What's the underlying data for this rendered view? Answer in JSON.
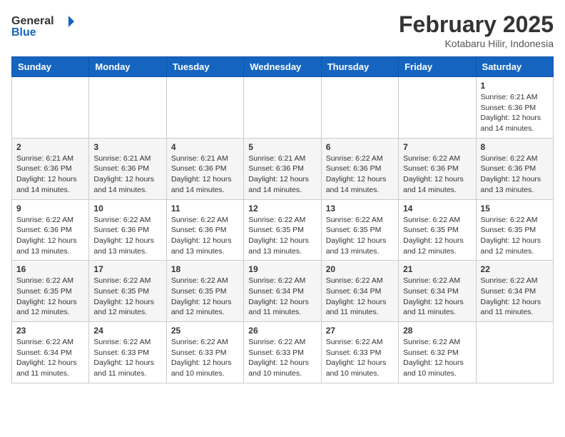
{
  "logo": {
    "line1": "General",
    "line2": "Blue"
  },
  "title": "February 2025",
  "location": "Kotabaru Hilir, Indonesia",
  "days_of_week": [
    "Sunday",
    "Monday",
    "Tuesday",
    "Wednesday",
    "Thursday",
    "Friday",
    "Saturday"
  ],
  "weeks": [
    [
      {
        "day": "",
        "info": ""
      },
      {
        "day": "",
        "info": ""
      },
      {
        "day": "",
        "info": ""
      },
      {
        "day": "",
        "info": ""
      },
      {
        "day": "",
        "info": ""
      },
      {
        "day": "",
        "info": ""
      },
      {
        "day": "1",
        "info": "Sunrise: 6:21 AM\nSunset: 6:36 PM\nDaylight: 12 hours\nand 14 minutes."
      }
    ],
    [
      {
        "day": "2",
        "info": "Sunrise: 6:21 AM\nSunset: 6:36 PM\nDaylight: 12 hours\nand 14 minutes."
      },
      {
        "day": "3",
        "info": "Sunrise: 6:21 AM\nSunset: 6:36 PM\nDaylight: 12 hours\nand 14 minutes."
      },
      {
        "day": "4",
        "info": "Sunrise: 6:21 AM\nSunset: 6:36 PM\nDaylight: 12 hours\nand 14 minutes."
      },
      {
        "day": "5",
        "info": "Sunrise: 6:21 AM\nSunset: 6:36 PM\nDaylight: 12 hours\nand 14 minutes."
      },
      {
        "day": "6",
        "info": "Sunrise: 6:22 AM\nSunset: 6:36 PM\nDaylight: 12 hours\nand 14 minutes."
      },
      {
        "day": "7",
        "info": "Sunrise: 6:22 AM\nSunset: 6:36 PM\nDaylight: 12 hours\nand 14 minutes."
      },
      {
        "day": "8",
        "info": "Sunrise: 6:22 AM\nSunset: 6:36 PM\nDaylight: 12 hours\nand 13 minutes."
      }
    ],
    [
      {
        "day": "9",
        "info": "Sunrise: 6:22 AM\nSunset: 6:36 PM\nDaylight: 12 hours\nand 13 minutes."
      },
      {
        "day": "10",
        "info": "Sunrise: 6:22 AM\nSunset: 6:36 PM\nDaylight: 12 hours\nand 13 minutes."
      },
      {
        "day": "11",
        "info": "Sunrise: 6:22 AM\nSunset: 6:36 PM\nDaylight: 12 hours\nand 13 minutes."
      },
      {
        "day": "12",
        "info": "Sunrise: 6:22 AM\nSunset: 6:35 PM\nDaylight: 12 hours\nand 13 minutes."
      },
      {
        "day": "13",
        "info": "Sunrise: 6:22 AM\nSunset: 6:35 PM\nDaylight: 12 hours\nand 13 minutes."
      },
      {
        "day": "14",
        "info": "Sunrise: 6:22 AM\nSunset: 6:35 PM\nDaylight: 12 hours\nand 12 minutes."
      },
      {
        "day": "15",
        "info": "Sunrise: 6:22 AM\nSunset: 6:35 PM\nDaylight: 12 hours\nand 12 minutes."
      }
    ],
    [
      {
        "day": "16",
        "info": "Sunrise: 6:22 AM\nSunset: 6:35 PM\nDaylight: 12 hours\nand 12 minutes."
      },
      {
        "day": "17",
        "info": "Sunrise: 6:22 AM\nSunset: 6:35 PM\nDaylight: 12 hours\nand 12 minutes."
      },
      {
        "day": "18",
        "info": "Sunrise: 6:22 AM\nSunset: 6:35 PM\nDaylight: 12 hours\nand 12 minutes."
      },
      {
        "day": "19",
        "info": "Sunrise: 6:22 AM\nSunset: 6:34 PM\nDaylight: 12 hours\nand 11 minutes."
      },
      {
        "day": "20",
        "info": "Sunrise: 6:22 AM\nSunset: 6:34 PM\nDaylight: 12 hours\nand 11 minutes."
      },
      {
        "day": "21",
        "info": "Sunrise: 6:22 AM\nSunset: 6:34 PM\nDaylight: 12 hours\nand 11 minutes."
      },
      {
        "day": "22",
        "info": "Sunrise: 6:22 AM\nSunset: 6:34 PM\nDaylight: 12 hours\nand 11 minutes."
      }
    ],
    [
      {
        "day": "23",
        "info": "Sunrise: 6:22 AM\nSunset: 6:34 PM\nDaylight: 12 hours\nand 11 minutes."
      },
      {
        "day": "24",
        "info": "Sunrise: 6:22 AM\nSunset: 6:33 PM\nDaylight: 12 hours\nand 11 minutes."
      },
      {
        "day": "25",
        "info": "Sunrise: 6:22 AM\nSunset: 6:33 PM\nDaylight: 12 hours\nand 10 minutes."
      },
      {
        "day": "26",
        "info": "Sunrise: 6:22 AM\nSunset: 6:33 PM\nDaylight: 12 hours\nand 10 minutes."
      },
      {
        "day": "27",
        "info": "Sunrise: 6:22 AM\nSunset: 6:33 PM\nDaylight: 12 hours\nand 10 minutes."
      },
      {
        "day": "28",
        "info": "Sunrise: 6:22 AM\nSunset: 6:32 PM\nDaylight: 12 hours\nand 10 minutes."
      },
      {
        "day": "",
        "info": ""
      }
    ]
  ]
}
